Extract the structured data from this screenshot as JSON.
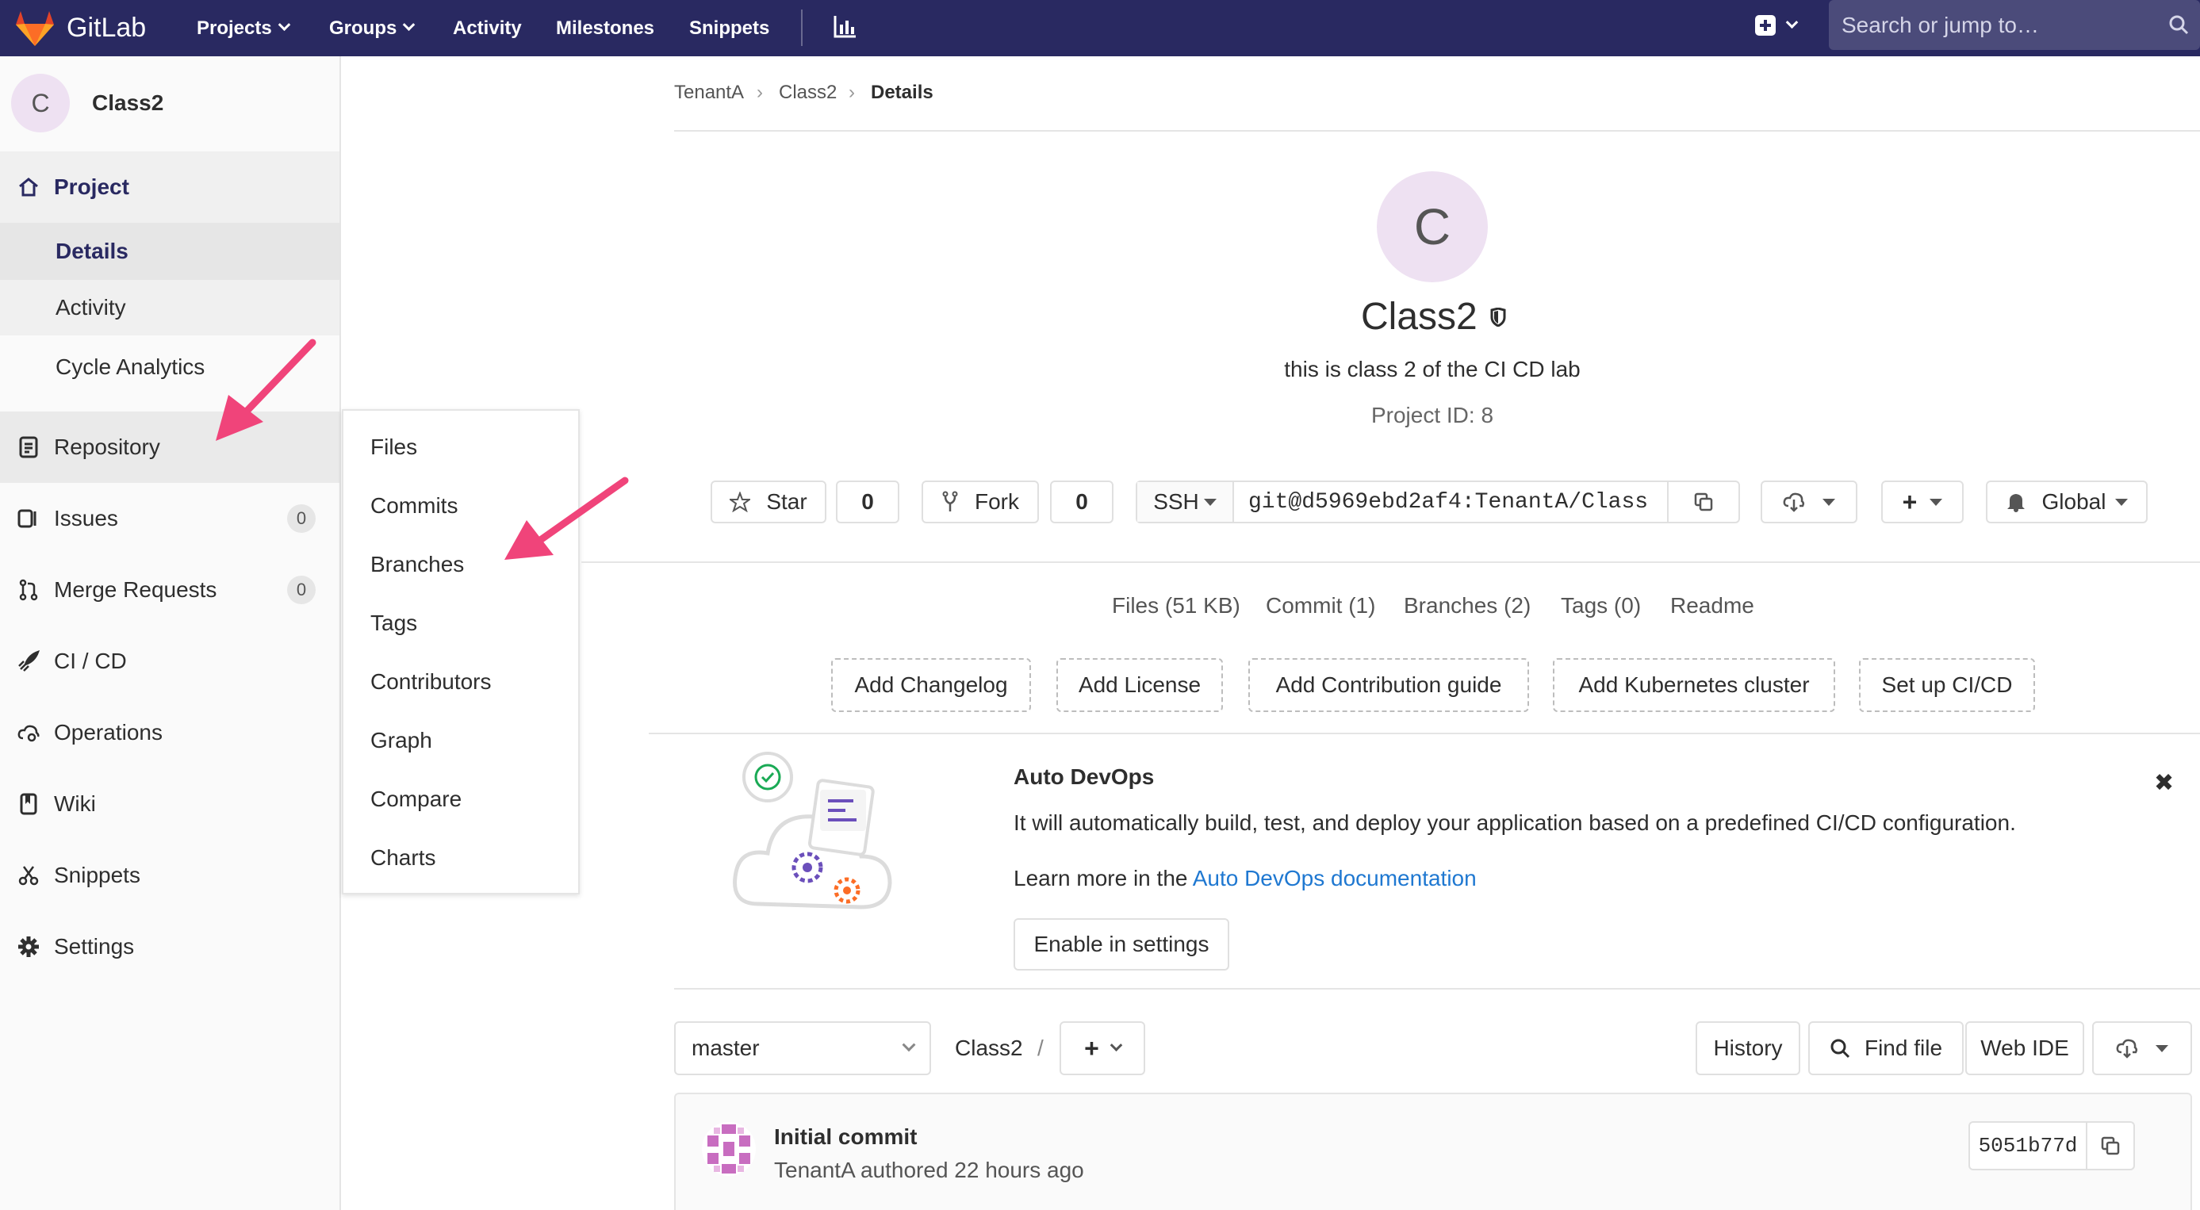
{
  "navbar": {
    "brand": "GitLab",
    "items": [
      {
        "label": "Projects",
        "dropdown": true
      },
      {
        "label": "Groups",
        "dropdown": true
      },
      {
        "label": "Activity",
        "dropdown": false
      },
      {
        "label": "Milestones",
        "dropdown": false
      },
      {
        "label": "Snippets",
        "dropdown": false
      }
    ],
    "search_placeholder": "Search or jump to…",
    "icons": [
      "chart-icon",
      "plus-square-icon",
      "search-icon"
    ]
  },
  "sidebar": {
    "project_letter": "C",
    "project_name": "Class2",
    "items": [
      {
        "label": "Project",
        "icon": "home-icon",
        "active": true
      },
      {
        "label": "Details",
        "sub": true,
        "active": true
      },
      {
        "label": "Activity",
        "sub": true
      },
      {
        "label": "Cycle Analytics",
        "sub": true
      },
      {
        "label": "Repository",
        "icon": "book-icon",
        "hover": true
      },
      {
        "label": "Issues",
        "icon": "issues-icon",
        "count": "0"
      },
      {
        "label": "Merge Requests",
        "icon": "merge-icon",
        "count": "0"
      },
      {
        "label": "CI / CD",
        "icon": "rocket-icon"
      },
      {
        "label": "Operations",
        "icon": "cloud-gear-icon"
      },
      {
        "label": "Wiki",
        "icon": "wiki-book-icon"
      },
      {
        "label": "Snippets",
        "icon": "scissors-icon"
      },
      {
        "label": "Settings",
        "icon": "gear-icon"
      }
    ]
  },
  "flyout": {
    "items": [
      "Files",
      "Commits",
      "Branches",
      "Tags",
      "Contributors",
      "Graph",
      "Compare",
      "Charts"
    ]
  },
  "breadcrumb": [
    "TenantA",
    "Class2",
    "Details"
  ],
  "project": {
    "letter": "C",
    "name": "Class2",
    "description": "this is class 2 of the CI CD lab",
    "id_text": "Project ID: 8"
  },
  "actions": {
    "star_label": "Star",
    "star_count": "0",
    "fork_label": "Fork",
    "fork_count": "0",
    "protocol": "SSH",
    "clone_url": "git@d5969ebd2af4:TenantA/Class",
    "notification": "Global"
  },
  "stats": [
    "Files (51 KB)",
    "Commit (1)",
    "Branches (2)",
    "Tags (0)",
    "Readme"
  ],
  "quick_add": [
    "Add Changelog",
    "Add License",
    "Add Contribution guide",
    "Add Kubernetes cluster",
    "Set up CI/CD"
  ],
  "autodevops": {
    "title": "Auto DevOps",
    "body": "It will automatically build, test, and deploy your application based on a predefined CI/CD configuration.",
    "learn_prefix": "Learn more in the ",
    "learn_link": "Auto DevOps documentation",
    "button": "Enable in settings",
    "close": "✖"
  },
  "repo": {
    "branch": "master",
    "path": "Class2",
    "separator": "/",
    "history": "History",
    "find_file": "Find file",
    "web_ide": "Web IDE"
  },
  "commit": {
    "title": "Initial commit",
    "meta": "TenantA authored 22 hours ago",
    "sha": "5051b77d"
  },
  "colors": {
    "navbar": "#292961",
    "accent": "#292961",
    "link": "#1f78d1",
    "arrow": "#f0447a",
    "avatar_bg": "#eee1f2"
  }
}
